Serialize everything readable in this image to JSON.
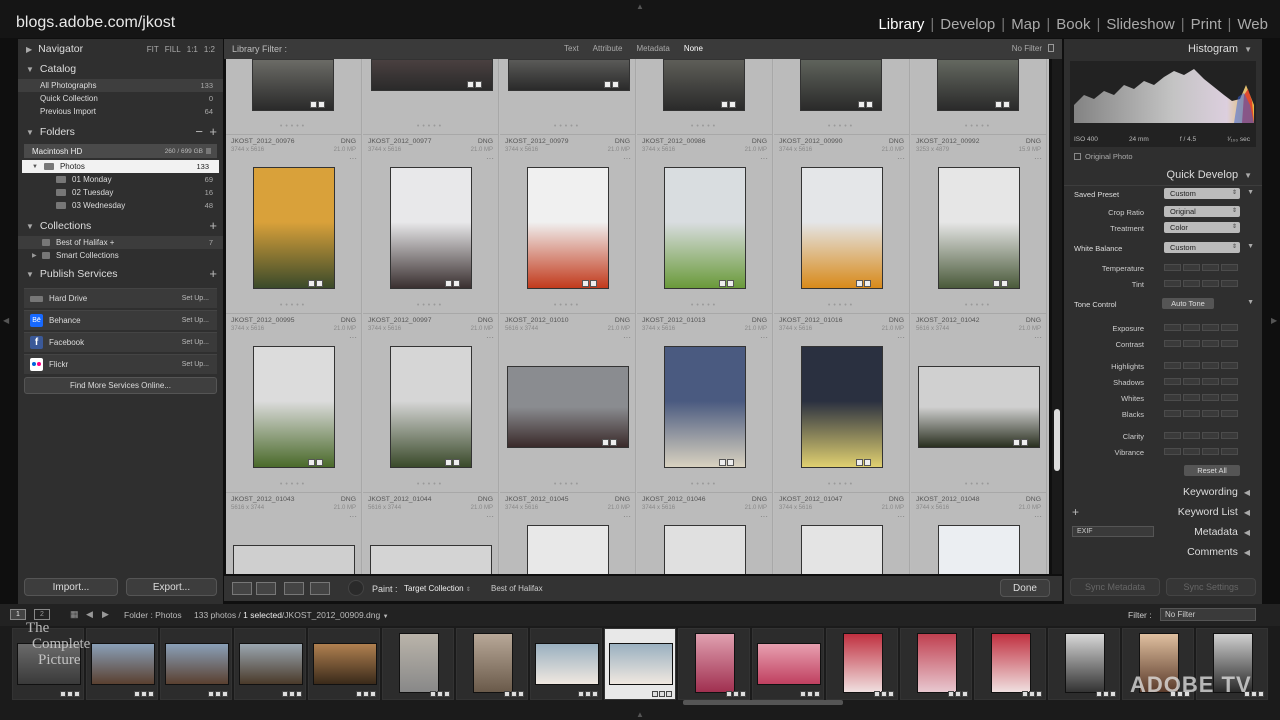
{
  "top": {
    "identity": "blogs.adobe.com/jkost",
    "modules": [
      "Library",
      "Develop",
      "Map",
      "Book",
      "Slideshow",
      "Print",
      "Web"
    ],
    "active_module": "Library"
  },
  "left_panel": {
    "navigator": {
      "title": "Navigator",
      "zoom": [
        "FIT",
        "FILL",
        "1:1",
        "1:2"
      ]
    },
    "catalog": {
      "title": "Catalog",
      "items": [
        {
          "label": "All Photographs",
          "count": "133"
        },
        {
          "label": "Quick Collection",
          "count": "0"
        },
        {
          "label": "Previous Import",
          "count": "64"
        }
      ]
    },
    "folders": {
      "title": "Folders",
      "volume": {
        "label": "Macintosh HD",
        "size": "260 / 699 GB"
      },
      "items": [
        {
          "label": "Photos",
          "count": "133"
        },
        {
          "label": "01 Monday",
          "count": "69"
        },
        {
          "label": "02 Tuesday",
          "count": "16"
        },
        {
          "label": "03 Wednesday",
          "count": "48"
        }
      ]
    },
    "collections": {
      "title": "Collections",
      "items": [
        {
          "label": "Best of Halifax  +",
          "count": "7"
        },
        {
          "label": "Smart Collections",
          "count": ""
        }
      ]
    },
    "publish": {
      "title": "Publish Services",
      "services": [
        {
          "label": "Hard Drive",
          "action": "Set Up...",
          "color": "#777777"
        },
        {
          "label": "Behance",
          "action": "Set Up...",
          "color": "#1769ff"
        },
        {
          "label": "Facebook",
          "action": "Set Up...",
          "color": "#3b5998"
        },
        {
          "label": "Flickr",
          "action": "Set Up...",
          "color": "#ffffff"
        }
      ],
      "find_more": "Find More Services Online..."
    },
    "import_label": "Import...",
    "export_label": "Export..."
  },
  "filter_bar": {
    "label": "Library Filter :",
    "options": [
      "Text",
      "Attribute",
      "Metadata",
      "None"
    ],
    "active": "None",
    "preset": "No Filter"
  },
  "grid": {
    "top_row": [
      {
        "color": "#6b6b66"
      },
      {
        "color": "#4a4040"
      },
      {
        "color": "#5a5a58"
      },
      {
        "color": "#5e5e58"
      },
      {
        "color": "#5f635c"
      },
      {
        "color": "#646860"
      }
    ],
    "rows": [
      [
        {
          "name": "JKOST_2012_00976",
          "ext": "DNG",
          "dims": "3744 x 5616",
          "mp": "21.0 MP",
          "c1": "#d9a13a",
          "c2": "#3a4a2a",
          "orient": "p"
        },
        {
          "name": "JKOST_2012_00977",
          "ext": "DNG",
          "dims": "3744 x 5616",
          "mp": "21.0 MP",
          "c1": "#e8e8ea",
          "c2": "#3a3030",
          "orient": "p"
        },
        {
          "name": "JKOST_2012_00979",
          "ext": "DNG",
          "dims": "3744 x 5616",
          "mp": "21.0 MP",
          "c1": "#f0f0f0",
          "c2": "#c23a1c",
          "orient": "p"
        },
        {
          "name": "JKOST_2012_00986",
          "ext": "DNG",
          "dims": "3744 x 5616",
          "mp": "21.0 MP",
          "c1": "#d9dde0",
          "c2": "#6a9a3a",
          "orient": "p"
        },
        {
          "name": "JKOST_2012_00990",
          "ext": "DNG",
          "dims": "3744 x 5616",
          "mp": "21.0 MP",
          "c1": "#e4e6e8",
          "c2": "#d88a1a",
          "orient": "p"
        },
        {
          "name": "JKOST_2012_00992",
          "ext": "DNG",
          "dims": "3253 x 4879",
          "mp": "15.9 MP",
          "c1": "#e6e6e6",
          "c2": "#4a5a3a",
          "orient": "p"
        }
      ],
      [
        {
          "name": "JKOST_2012_00995",
          "ext": "DNG",
          "dims": "3744 x 5616",
          "mp": "21.0 MP",
          "c1": "#dcdcdc",
          "c2": "#4a6a2a",
          "orient": "p"
        },
        {
          "name": "JKOST_2012_00997",
          "ext": "DNG",
          "dims": "3744 x 5616",
          "mp": "21.0 MP",
          "c1": "#d6d6d6",
          "c2": "#3a4a2a",
          "orient": "p"
        },
        {
          "name": "JKOST_2012_01010",
          "ext": "DNG",
          "dims": "5616 x 3744",
          "mp": "21.0 MP",
          "c1": "#8a8c90",
          "c2": "#3a2a2a",
          "orient": "l"
        },
        {
          "name": "JKOST_2012_01013",
          "ext": "DNG",
          "dims": "3744 x 5616",
          "mp": "21.0 MP",
          "c1": "#4a5a80",
          "c2": "#d9d2c0",
          "orient": "p"
        },
        {
          "name": "JKOST_2012_01016",
          "ext": "DNG",
          "dims": "3744 x 5616",
          "mp": "21.0 MP",
          "c1": "#2a3040",
          "c2": "#e0d070",
          "orient": "p"
        },
        {
          "name": "JKOST_2012_01042",
          "ext": "DNG",
          "dims": "5616 x 3744",
          "mp": "21.0 MP",
          "c1": "#d0d0d0",
          "c2": "#2a3020",
          "orient": "l"
        }
      ],
      [
        {
          "name": "JKOST_2012_01043",
          "ext": "DNG",
          "dims": "5616 x 3744",
          "mp": "21.0 MP",
          "c1": "#cfcfcf",
          "c2": "#777",
          "orient": "l"
        },
        {
          "name": "JKOST_2012_01044",
          "ext": "DNG",
          "dims": "5616 x 3744",
          "mp": "21.0 MP",
          "c1": "#d4d4d4",
          "c2": "#777",
          "orient": "l"
        },
        {
          "name": "JKOST_2012_01045",
          "ext": "DNG",
          "dims": "3744 x 5616",
          "mp": "21.0 MP",
          "c1": "#e8e8e8",
          "c2": "#999",
          "orient": "p"
        },
        {
          "name": "JKOST_2012_01046",
          "ext": "DNG",
          "dims": "3744 x 5616",
          "mp": "21.0 MP",
          "c1": "#e0e0e0",
          "c2": "#555",
          "orient": "p"
        },
        {
          "name": "JKOST_2012_01047",
          "ext": "DNG",
          "dims": "3744 x 5616",
          "mp": "21.0 MP",
          "c1": "#e4e4e4",
          "c2": "#555",
          "orient": "p"
        },
        {
          "name": "JKOST_2012_01048",
          "ext": "DNG",
          "dims": "3744 x 5616",
          "mp": "21.0 MP",
          "c1": "#ebeef2",
          "c2": "#333",
          "orient": "p"
        }
      ]
    ]
  },
  "toolbar": {
    "paint_label": "Paint :",
    "target": "Target Collection",
    "collection": "Best of Halifax",
    "done": "Done"
  },
  "right_panel": {
    "histogram": {
      "title": "Histogram",
      "iso": "ISO 400",
      "focal": "24 mm",
      "aperture": "f / 4.5",
      "shutter": "¹⁄₁₀₀ sec",
      "original_photo": "Original Photo"
    },
    "quick_develop": {
      "title": "Quick Develop",
      "saved_preset_label": "Saved Preset",
      "saved_preset": "Custom",
      "crop_label": "Crop Ratio",
      "crop": "Original",
      "treatment_label": "Treatment",
      "treatment": "Color",
      "wb_label": "White Balance",
      "wb": "Custom",
      "temperature": "Temperature",
      "tint": "Tint",
      "tone_label": "Tone Control",
      "auto_tone": "Auto Tone",
      "exposure": "Exposure",
      "contrast": "Contrast",
      "highlights": "Highlights",
      "shadows": "Shadows",
      "whites": "Whites",
      "blacks": "Blacks",
      "clarity": "Clarity",
      "vibrance": "Vibrance",
      "reset": "Reset All"
    },
    "keywording": "Keywording",
    "keyword_list": "Keyword List",
    "metadata": "Metadata",
    "metadata_preset": "EXIF",
    "comments": "Comments",
    "sync_metadata": "Sync Metadata",
    "sync_settings": "Sync Settings"
  },
  "filmstrip_header": {
    "screen1": "1",
    "screen2": "2",
    "path": "Folder : Photos",
    "count_prefix": "133 photos /",
    "selected": "1 selected",
    "file": "/JKOST_2012_00909.dng",
    "filter_label": "Filter :",
    "filter_value": "No Filter"
  },
  "filmstrip": {
    "thumbs": [
      {
        "c1": "#6a6a6a",
        "c2": "#3a3a3a",
        "o": "l"
      },
      {
        "c1": "#8aa0b8",
        "c2": "#5a4030",
        "o": "l"
      },
      {
        "c1": "#8aa0b8",
        "c2": "#5a4030",
        "o": "l"
      },
      {
        "c1": "#9aa6b0",
        "c2": "#4a3a2a",
        "o": "l"
      },
      {
        "c1": "#b08050",
        "c2": "#3a2a1a",
        "o": "l"
      },
      {
        "c1": "#bab4aa",
        "c2": "#888",
        "o": "p"
      },
      {
        "c1": "#b8a898",
        "c2": "#6a5a4a",
        "o": "p"
      },
      {
        "c1": "#9ab0c0",
        "c2": "#f0e8e0",
        "o": "l"
      },
      {
        "c1": "#9ab0c0",
        "c2": "#f0e8e0",
        "o": "l"
      },
      {
        "c1": "#e0a0b0",
        "c2": "#a03050",
        "o": "p"
      },
      {
        "c1": "#e8a0b0",
        "c2": "#c04060",
        "o": "l"
      },
      {
        "c1": "#c03040",
        "c2": "#f0e0e0",
        "o": "p"
      },
      {
        "c1": "#c04050",
        "c2": "#e8c8d0",
        "o": "p"
      },
      {
        "c1": "#c03040",
        "c2": "#f0e0e0",
        "o": "p"
      },
      {
        "c1": "#d8d8d8",
        "c2": "#333",
        "o": "p"
      },
      {
        "c1": "#e0c0a0",
        "c2": "#5a3a2a",
        "o": "p"
      },
      {
        "c1": "#d0d0d0",
        "c2": "#2a2a2a",
        "o": "p"
      }
    ],
    "selected_index": 8
  },
  "watermarks": {
    "left": "The Complete Picture",
    "right": "ADOBE TV"
  }
}
